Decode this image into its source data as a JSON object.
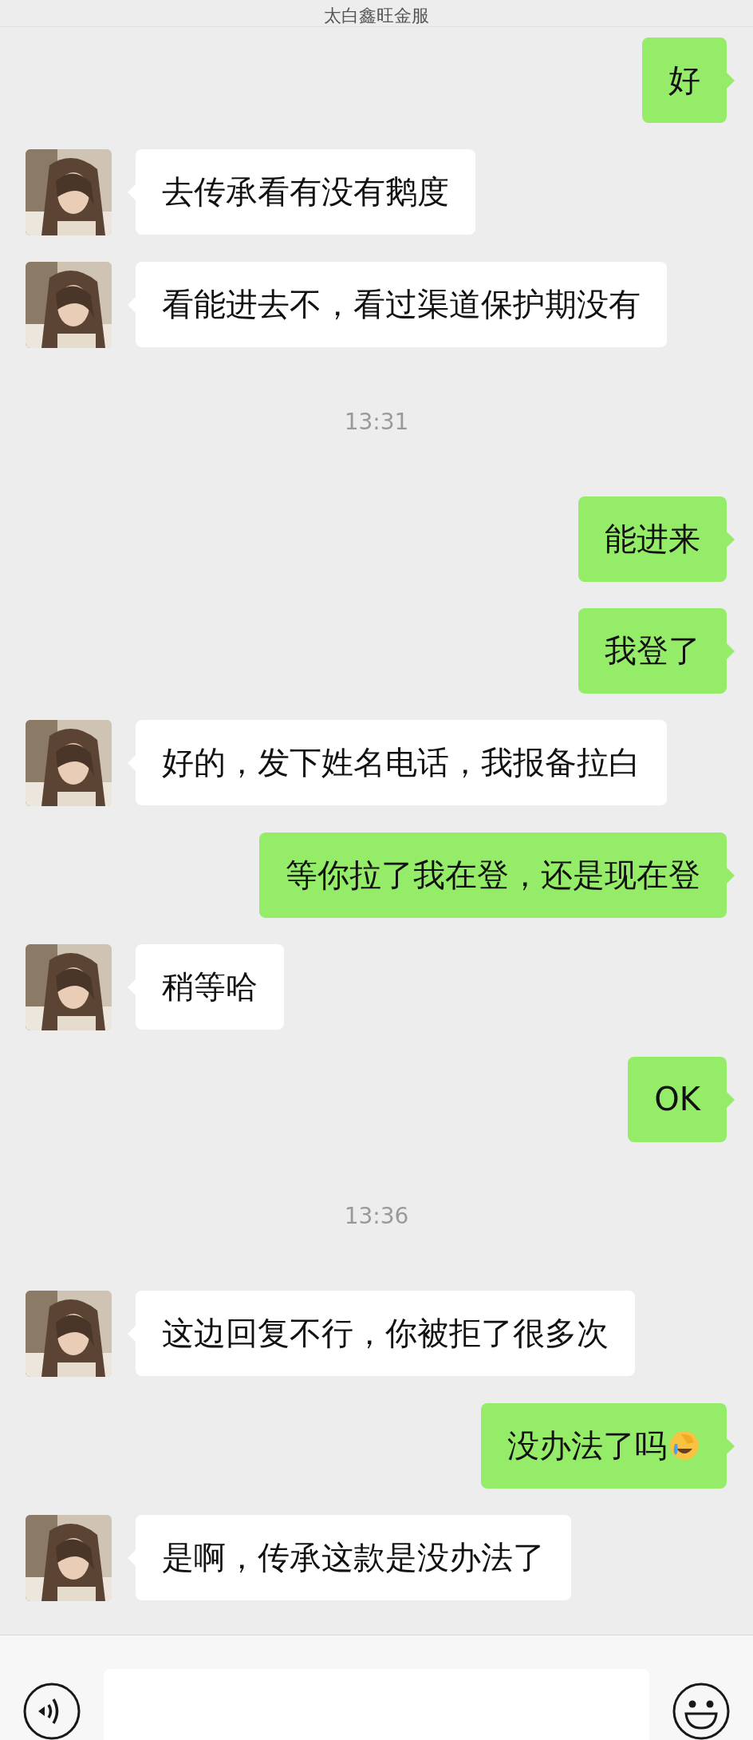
{
  "header": {
    "title": "太白鑫旺金服"
  },
  "messages": [
    {
      "kind": "sent",
      "text": "好",
      "emoji": false
    },
    {
      "kind": "received",
      "text": "去传承看有没有鹅度",
      "emoji": false
    },
    {
      "kind": "received",
      "text": "看能进去不，看过渠道保护期没有",
      "emoji": false
    },
    {
      "kind": "time",
      "text": "13:31"
    },
    {
      "kind": "sent",
      "text": "能进来",
      "emoji": false
    },
    {
      "kind": "sent",
      "text": "我登了",
      "emoji": false
    },
    {
      "kind": "received",
      "text": "好的，发下姓名电话，我报备拉白",
      "emoji": false
    },
    {
      "kind": "sent",
      "text": "等你拉了我在登，还是现在登",
      "emoji": false
    },
    {
      "kind": "received",
      "text": "稍等哈",
      "emoji": false
    },
    {
      "kind": "sent",
      "text": "OK",
      "emoji": false
    },
    {
      "kind": "time",
      "text": "13:36"
    },
    {
      "kind": "received",
      "text": "这边回复不行，你被拒了很多次",
      "emoji": false
    },
    {
      "kind": "sent",
      "text": "没办法了吗",
      "emoji": true
    },
    {
      "kind": "received",
      "text": "是啊，传承这款是没办法了",
      "emoji": false
    }
  ]
}
